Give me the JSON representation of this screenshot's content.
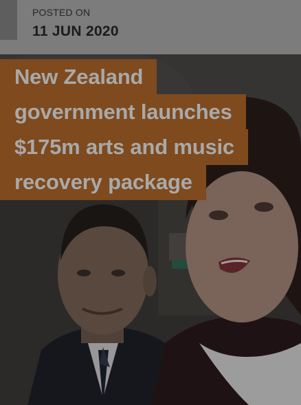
{
  "post": {
    "posted_label": "POSTED ON",
    "date": "11 JUN 2020"
  },
  "headline": {
    "lines": [
      "New Zealand",
      "government launches",
      "$175m arts and music",
      "recovery package"
    ]
  },
  "colors": {
    "headline_bg": "#7e4a1e",
    "headline_text": "#a9a9a9",
    "date_bar_bg": "#7c7c7c"
  }
}
